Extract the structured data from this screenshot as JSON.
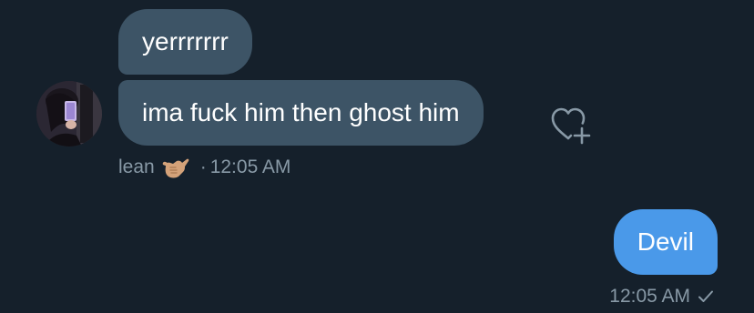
{
  "conversation": {
    "messages": [
      {
        "text": "yerrrrrrr",
        "direction": "incoming"
      },
      {
        "text": "ima fuck him then ghost him",
        "direction": "incoming"
      },
      {
        "text": "Devil",
        "direction": "outgoing"
      }
    ],
    "incoming_meta": {
      "sender": "lean",
      "separator": "·",
      "time": "12:05 AM",
      "emoji": "call-me-hand-emoji"
    },
    "outgoing_meta": {
      "time": "12:05 AM",
      "status_icon": "check-icon"
    },
    "react_icon": "heart-add-icon",
    "colors": {
      "background": "#15202b",
      "incoming_bubble": "#3d5466",
      "outgoing_bubble": "#4a99e9",
      "meta_text": "#8899a6"
    }
  }
}
